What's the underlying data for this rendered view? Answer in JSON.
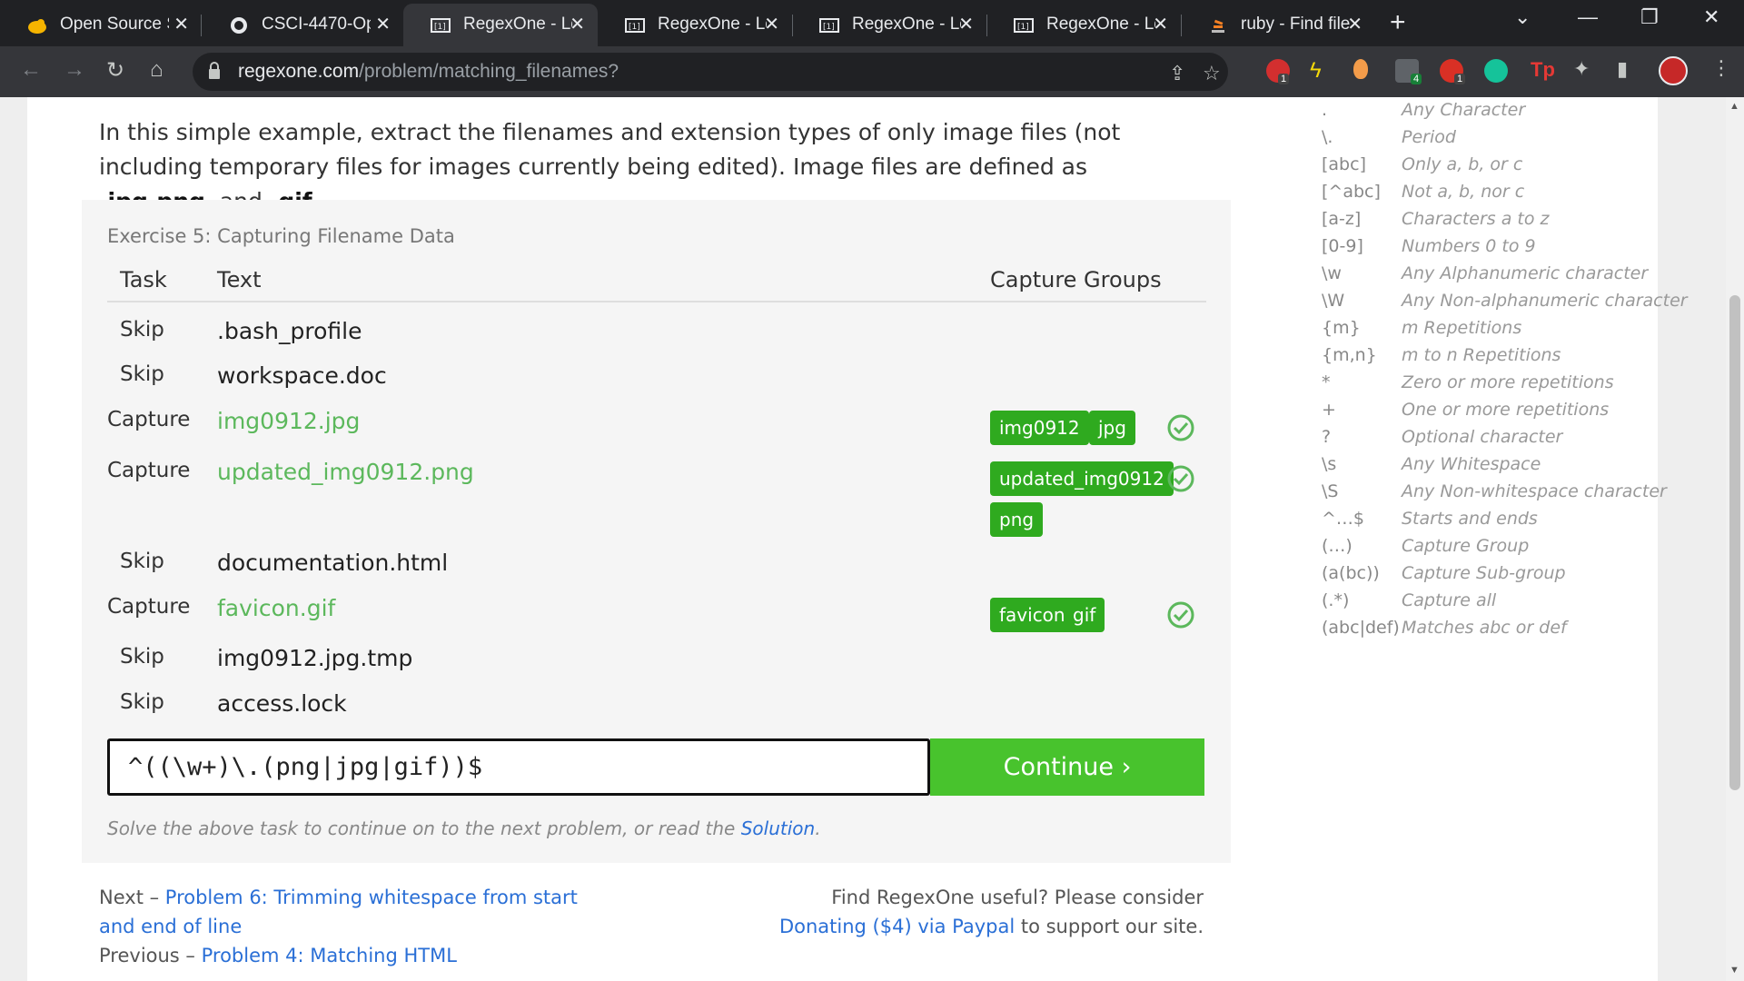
{
  "tabs": [
    {
      "title": "Open Source S",
      "icon": "duck-icon"
    },
    {
      "title": "CSCI-4470-Op",
      "icon": "github-icon"
    },
    {
      "title": "RegexOne - Le",
      "icon": "regexone-icon",
      "active": true
    },
    {
      "title": "RegexOne - Le",
      "icon": "regexone-icon"
    },
    {
      "title": "RegexOne - Le",
      "icon": "regexone-icon"
    },
    {
      "title": "RegexOne - Le",
      "icon": "regexone-icon"
    },
    {
      "title": "ruby - Find file",
      "icon": "stackoverflow-icon"
    }
  ],
  "address": {
    "host": "regexone.com",
    "path": "/problem/matching_filenames?"
  },
  "intro": {
    "before": "In this simple example, extract the filenames and extension types of only image files (not including temporary files for images currently being edited). Image files are defined as ",
    "ext1": ".jpg",
    "ext2": ".png",
    "mid": ", and ",
    "ext3": ".gif",
    "end": "."
  },
  "exercise": {
    "title": "Exercise 5: Capturing Filename Data",
    "col_task": "Task",
    "col_text": "Text",
    "col_groups": "Capture Groups",
    "rows": [
      {
        "task": "Skip",
        "text": ".bash_profile",
        "groups": []
      },
      {
        "task": "Skip",
        "text": "workspace.doc",
        "groups": []
      },
      {
        "task": "Capture",
        "text": "img0912.jpg",
        "groups": [
          "img0912",
          "jpg"
        ]
      },
      {
        "task": "Capture",
        "text": "updated_img0912.png",
        "groups": [
          "updated_img0912",
          "png"
        ]
      },
      {
        "task": "Skip",
        "text": "documentation.html",
        "groups": []
      },
      {
        "task": "Capture",
        "text": "favicon.gif",
        "groups": [
          "favicon",
          "gif"
        ]
      },
      {
        "task": "Skip",
        "text": "img0912.jpg.tmp",
        "groups": []
      },
      {
        "task": "Skip",
        "text": "access.lock",
        "groups": []
      }
    ],
    "input_value": "^((\\w+)\\.(png|jpg|gif))$",
    "continue_label": "Continue ›",
    "hint_text": "Solve the above task to continue on to the next problem, or read the ",
    "hint_link": "Solution",
    "hint_end": "."
  },
  "nav": {
    "next_prefix": "Next – ",
    "next_link": "Problem 6: Trimming whitespace from start and end of line",
    "prev_prefix": "Previous – ",
    "prev_link": "Problem 4: Matching HTML"
  },
  "donate": {
    "text1": "Find RegexOne useful? Please consider",
    "link": "Donating ($4) via Paypal",
    "text2": " to support our site."
  },
  "cheatsheet": [
    {
      "sym": ".",
      "desc": "Any Character"
    },
    {
      "sym": "\\.",
      "desc": "Period"
    },
    {
      "sym": "[abc]",
      "desc": "Only a, b, or c"
    },
    {
      "sym": "[^abc]",
      "desc": "Not a, b, nor c"
    },
    {
      "sym": "[a-z]",
      "desc": "Characters a to z"
    },
    {
      "sym": "[0-9]",
      "desc": "Numbers 0 to 9"
    },
    {
      "sym": "\\w",
      "desc": "Any Alphanumeric character"
    },
    {
      "sym": "\\W",
      "desc": "Any Non-alphanumeric character"
    },
    {
      "sym": "{m}",
      "desc": "m Repetitions"
    },
    {
      "sym": "{m,n}",
      "desc": "m to n Repetitions"
    },
    {
      "sym": "*",
      "desc": "Zero or more repetitions"
    },
    {
      "sym": "+",
      "desc": "One or more repetitions"
    },
    {
      "sym": "?",
      "desc": "Optional character"
    },
    {
      "sym": "\\s",
      "desc": "Any Whitespace"
    },
    {
      "sym": "\\S",
      "desc": "Any Non-whitespace character"
    },
    {
      "sym": "^…$",
      "desc": "Starts and ends"
    },
    {
      "sym": "(…)",
      "desc": "Capture Group"
    },
    {
      "sym": "(a(bc))",
      "desc": "Capture Sub-group"
    },
    {
      "sym": "(.*)",
      "desc": "Capture all"
    },
    {
      "sym": "(abc|def)",
      "desc": "Matches abc or def"
    }
  ],
  "extension_badges": [
    "1",
    "4",
    "1"
  ],
  "colors": {
    "capture_green": "#5cb85c",
    "chip_green": "#2faa1f",
    "continue_green": "#48c32d",
    "link_blue": "#2a6fd6"
  }
}
